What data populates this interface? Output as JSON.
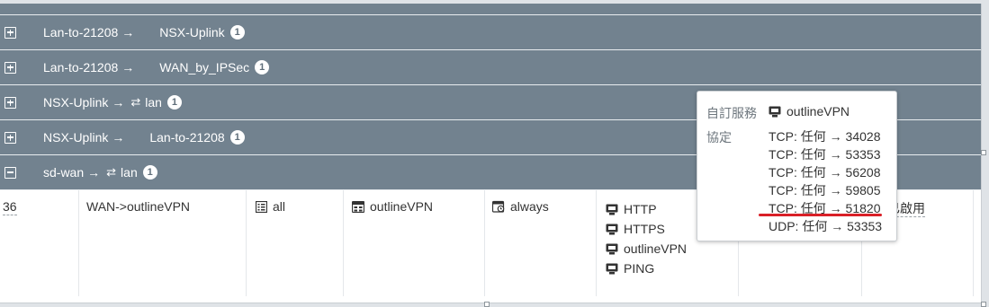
{
  "groups": [
    {
      "state": "collapsed",
      "src": "Lan-to-21208",
      "arrow": "→",
      "sd": "",
      "dst": "NSX-Uplink",
      "count": "1"
    },
    {
      "state": "collapsed",
      "src": "Lan-to-21208",
      "arrow": "→",
      "sd": "",
      "dst": "WAN_by_IPSec",
      "count": "1"
    },
    {
      "state": "collapsed",
      "src": "NSX-Uplink",
      "arrow": "→",
      "sd": "⇄",
      "dst": "lan",
      "count": "1"
    },
    {
      "state": "collapsed",
      "src": "NSX-Uplink",
      "arrow": "→",
      "sd": "",
      "dst": "Lan-to-21208",
      "count": "1"
    },
    {
      "state": "expanded",
      "src": "sd-wan",
      "arrow": "→",
      "sd": "⇄",
      "dst": "lan",
      "count": "1"
    }
  ],
  "policy": {
    "id": "36",
    "name": "WAN->outlineVPN",
    "source": "all",
    "destination": "outlineVPN",
    "schedule": "always",
    "services": [
      "HTTP",
      "HTTPS",
      "outlineVPN",
      "PING"
    ],
    "status": "已啟用"
  },
  "tooltip": {
    "service_label": "自訂服務",
    "service_name": "outlineVPN",
    "protocol_label": "協定",
    "protocols": [
      "TCP: 任何 → 34028",
      "TCP: 任何 → 53353",
      "TCP: 任何 → 56208",
      "TCP: 任何 → 59805",
      "TCP: 任何 → 51820",
      "UDP: 任何 → 53353"
    ],
    "highlight_color": "#d92027"
  }
}
